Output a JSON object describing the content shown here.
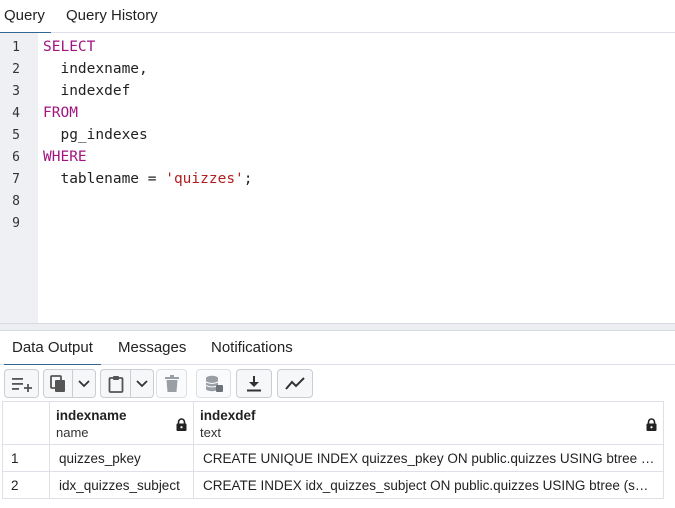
{
  "top_tabs": [
    {
      "label": "Query",
      "active": true
    },
    {
      "label": "Query History",
      "active": false
    }
  ],
  "editor": {
    "line_numbers": [
      "1",
      "2",
      "3",
      "4",
      "5",
      "6",
      "7",
      "8",
      "9"
    ],
    "lines": [
      {
        "keyword": "SELECT",
        "text": "",
        "string": "",
        "tail": ""
      },
      {
        "keyword": "",
        "text": "  indexname,",
        "string": "",
        "tail": ""
      },
      {
        "keyword": "",
        "text": "  indexdef",
        "string": "",
        "tail": ""
      },
      {
        "keyword": "FROM",
        "text": "",
        "string": "",
        "tail": ""
      },
      {
        "keyword": "",
        "text": "  pg_indexes",
        "string": "",
        "tail": ""
      },
      {
        "keyword": "WHERE",
        "text": "",
        "string": "",
        "tail": ""
      },
      {
        "keyword": "",
        "text": "  tablename = ",
        "string": "'quizzes'",
        "tail": ";"
      },
      {
        "keyword": "",
        "text": "",
        "string": "",
        "tail": ""
      },
      {
        "keyword": "",
        "text": "",
        "string": "",
        "tail": ""
      }
    ],
    "colors": {
      "keyword": "#a0147f",
      "string": "#b01f1f",
      "gutter": "#eef0f3"
    }
  },
  "bottom_tabs": [
    {
      "label": "Data Output",
      "active": true
    },
    {
      "label": "Messages",
      "active": false
    },
    {
      "label": "Notifications",
      "active": false
    }
  ],
  "toolbar": {
    "buttons": [
      {
        "icon": "add-row-icon"
      },
      {
        "icon": "copy-icon"
      },
      {
        "icon": "chevron-down-icon"
      },
      {
        "icon": "paste-icon"
      },
      {
        "icon": "chevron-down-icon"
      },
      {
        "icon": "delete-icon"
      },
      {
        "icon": "save-data-icon"
      },
      {
        "icon": "download-icon"
      },
      {
        "icon": "graph-icon"
      }
    ]
  },
  "grid": {
    "columns": [
      {
        "name": "indexname",
        "type": "name"
      },
      {
        "name": "indexdef",
        "type": "text"
      }
    ],
    "rows": [
      {
        "num": "1",
        "indexname": "quizzes_pkey",
        "indexdef": "CREATE UNIQUE INDEX quizzes_pkey ON public.quizzes USING btree (id)"
      },
      {
        "num": "2",
        "indexname": "idx_quizzes_subject",
        "indexdef": "CREATE INDEX idx_quizzes_subject ON public.quizzes USING btree (subject)"
      }
    ],
    "accent": "#326690"
  }
}
